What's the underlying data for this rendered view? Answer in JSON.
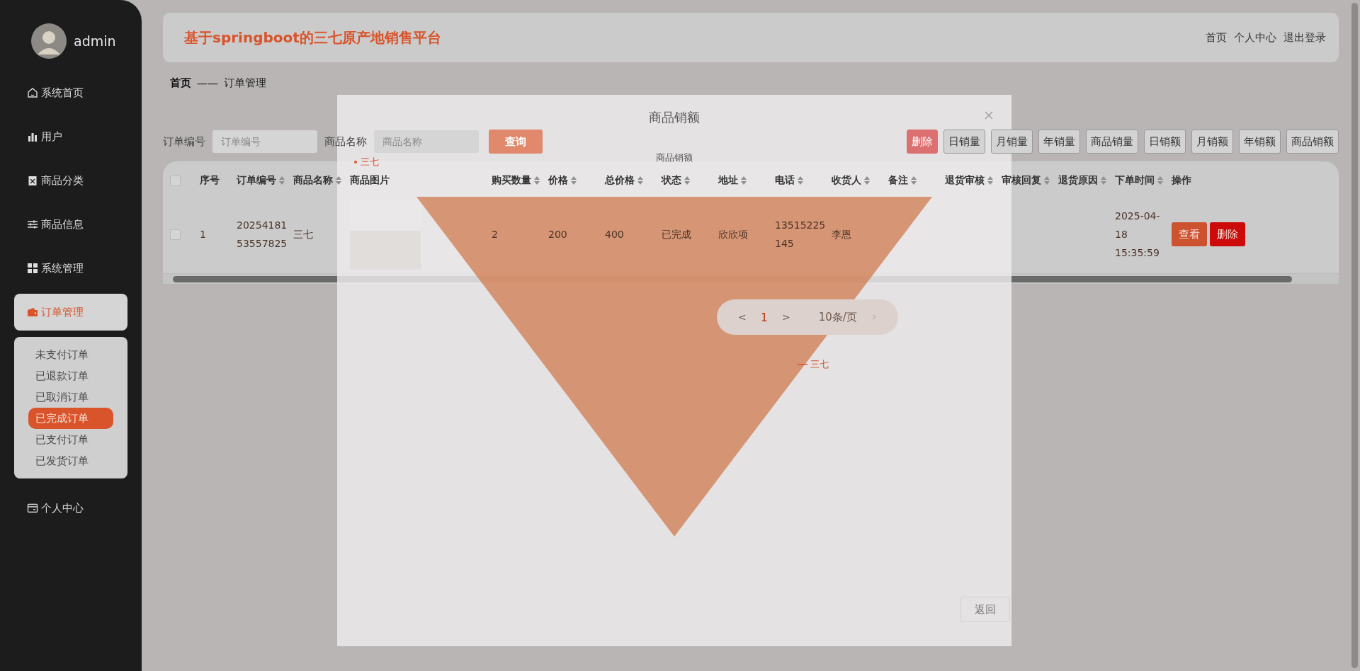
{
  "sidebar": {
    "user": {
      "name": "admin"
    },
    "items": [
      {
        "label": "系统首页",
        "selected": false
      },
      {
        "label": "用户",
        "selected": false
      },
      {
        "label": "商品分类",
        "selected": false
      },
      {
        "label": "商品信息",
        "selected": false
      },
      {
        "label": "系统管理",
        "selected": false
      },
      {
        "label": "订单管理",
        "selected": true,
        "expanded": true,
        "children": [
          {
            "label": "未支付订单",
            "selected": false
          },
          {
            "label": "已退款订单",
            "selected": false
          },
          {
            "label": "已取消订单",
            "selected": false
          },
          {
            "label": "已完成订单",
            "selected": true
          },
          {
            "label": "已支付订单",
            "selected": false
          },
          {
            "label": "已发货订单",
            "selected": false
          }
        ]
      },
      {
        "label": "个人中心",
        "selected": false
      }
    ]
  },
  "header": {
    "title": "基于springboot的三七原产地销售平台",
    "links": [
      "首页",
      "个人中心",
      "退出登录"
    ]
  },
  "breadcrumb": {
    "home": "首页",
    "separator": "——",
    "current": "订单管理"
  },
  "search": {
    "fields": [
      {
        "label": "订单编号",
        "placeholder": "订单编号"
      },
      {
        "label": "商品名称",
        "placeholder": "商品名称"
      }
    ],
    "button": "查询"
  },
  "toolbar": [
    {
      "label": "删除",
      "kind": "danger"
    },
    {
      "label": "日销量",
      "kind": "plain"
    },
    {
      "label": "月销量",
      "kind": "plain"
    },
    {
      "label": "年销量",
      "kind": "plain"
    },
    {
      "label": "商品销量",
      "kind": "plain"
    },
    {
      "label": "日销额",
      "kind": "plain"
    },
    {
      "label": "月销额",
      "kind": "plain"
    },
    {
      "label": "年销额",
      "kind": "plain"
    },
    {
      "label": "商品销额",
      "kind": "plain"
    }
  ],
  "table": {
    "header_checked": false,
    "columns": [
      {
        "label": "序号",
        "sortable": false,
        "kind": "narrow"
      },
      {
        "label": "订单编号",
        "sortable": true,
        "kind": "normal"
      },
      {
        "label": "商品名称",
        "sortable": true,
        "kind": "normal"
      },
      {
        "label": "商品图片",
        "sortable": false,
        "kind": "image"
      },
      {
        "label": "购买数量",
        "sortable": true,
        "kind": "normal"
      },
      {
        "label": "价格",
        "sortable": true,
        "kind": "normal"
      },
      {
        "label": "总价格",
        "sortable": true,
        "kind": "normal"
      },
      {
        "label": "状态",
        "sortable": true,
        "kind": "normal"
      },
      {
        "label": "地址",
        "sortable": true,
        "kind": "normal"
      },
      {
        "label": "电话",
        "sortable": true,
        "kind": "normal"
      },
      {
        "label": "收货人",
        "sortable": true,
        "kind": "normal"
      },
      {
        "label": "备注",
        "sortable": true,
        "kind": "normal"
      },
      {
        "label": "退货审核",
        "sortable": true,
        "kind": "normal"
      },
      {
        "label": "审核回复",
        "sortable": true,
        "kind": "normal"
      },
      {
        "label": "退货原因",
        "sortable": true,
        "kind": "normal"
      },
      {
        "label": "下单时间",
        "sortable": true,
        "kind": "time"
      },
      {
        "label": "操作",
        "sortable": false,
        "kind": "actions"
      }
    ],
    "rows": [
      {
        "checked": false,
        "cells": [
          {
            "kind": "text",
            "text": "1"
          },
          {
            "kind": "text",
            "text": "2025418153557825"
          },
          {
            "kind": "text",
            "text": "三七"
          },
          {
            "kind": "image"
          },
          {
            "kind": "text",
            "text": "2"
          },
          {
            "kind": "text",
            "text": "200"
          },
          {
            "kind": "text",
            "text": "400"
          },
          {
            "kind": "text",
            "text": "已完成"
          },
          {
            "kind": "text",
            "text": "欣欣项"
          },
          {
            "kind": "text",
            "text": "13515225145"
          },
          {
            "kind": "text",
            "text": "李恩"
          },
          {
            "kind": "empty"
          },
          {
            "kind": "empty"
          },
          {
            "kind": "empty"
          },
          {
            "kind": "empty"
          },
          {
            "kind": "text",
            "text": "2025-04-18 15:35:59"
          },
          {
            "kind": "actions",
            "buttons": [
              {
                "label": "查看",
                "kind": "primary"
              },
              {
                "label": "删除",
                "kind": "danger"
              }
            ]
          }
        ]
      }
    ]
  },
  "pagination": {
    "prev": "<",
    "page": "1",
    "next": ">",
    "size": "10条/页"
  },
  "modal": {
    "title": "商品销额",
    "chart": {
      "title": "商品销额",
      "legend": [
        "三七"
      ],
      "labels": [
        "三七"
      ]
    },
    "button": "返回"
  }
}
